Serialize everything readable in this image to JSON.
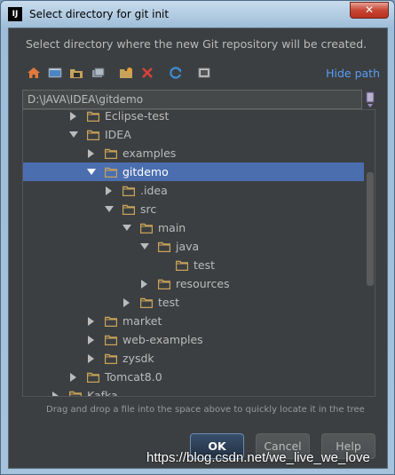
{
  "window": {
    "title": "Select directory for git init",
    "logo": "IJ",
    "close_label": "✕"
  },
  "description": "Select directory where the new Git repository will be created.",
  "toolbar": {
    "icons": [
      "home-icon",
      "desktop-icon",
      "project-folder-icon",
      "module-folder-icon",
      "new-folder-icon",
      "delete-icon",
      "refresh-icon",
      "show-hidden-icon"
    ],
    "hide_path_label": "Hide path"
  },
  "path": {
    "value": "D:\\JAVA\\IDEA\\gitdemo"
  },
  "tree": {
    "rows": [
      {
        "label": "Eclipse-test",
        "depth": 2,
        "arrow": "right"
      },
      {
        "label": "IDEA",
        "depth": 2,
        "arrow": "down"
      },
      {
        "label": "examples",
        "depth": 3,
        "arrow": "right"
      },
      {
        "label": "gitdemo",
        "depth": 3,
        "arrow": "down",
        "selected": true
      },
      {
        "label": ".idea",
        "depth": 4,
        "arrow": "right"
      },
      {
        "label": "src",
        "depth": 4,
        "arrow": "down"
      },
      {
        "label": "main",
        "depth": 5,
        "arrow": "down"
      },
      {
        "label": "java",
        "depth": 6,
        "arrow": "down"
      },
      {
        "label": "test",
        "depth": 7,
        "arrow": "none"
      },
      {
        "label": "resources",
        "depth": 6,
        "arrow": "right"
      },
      {
        "label": "test",
        "depth": 5,
        "arrow": "right"
      },
      {
        "label": "market",
        "depth": 3,
        "arrow": "right"
      },
      {
        "label": "web-examples",
        "depth": 3,
        "arrow": "right"
      },
      {
        "label": "zysdk",
        "depth": 3,
        "arrow": "right"
      },
      {
        "label": "Tomcat8.0",
        "depth": 2,
        "arrow": "right"
      },
      {
        "label": "Kafka",
        "depth": 1,
        "arrow": "right"
      }
    ]
  },
  "hint": "Drag and drop a file into the space above to quickly locate it in the tree",
  "buttons": {
    "ok": "OK",
    "cancel": "Cancel",
    "help": "Help"
  },
  "watermark": "https://blog.csdn.net/we_live_we_love",
  "colors": {
    "background": "#3c3f41",
    "selection": "#4b6eaf",
    "link": "#589df6",
    "folder": "#c7a35a"
  }
}
